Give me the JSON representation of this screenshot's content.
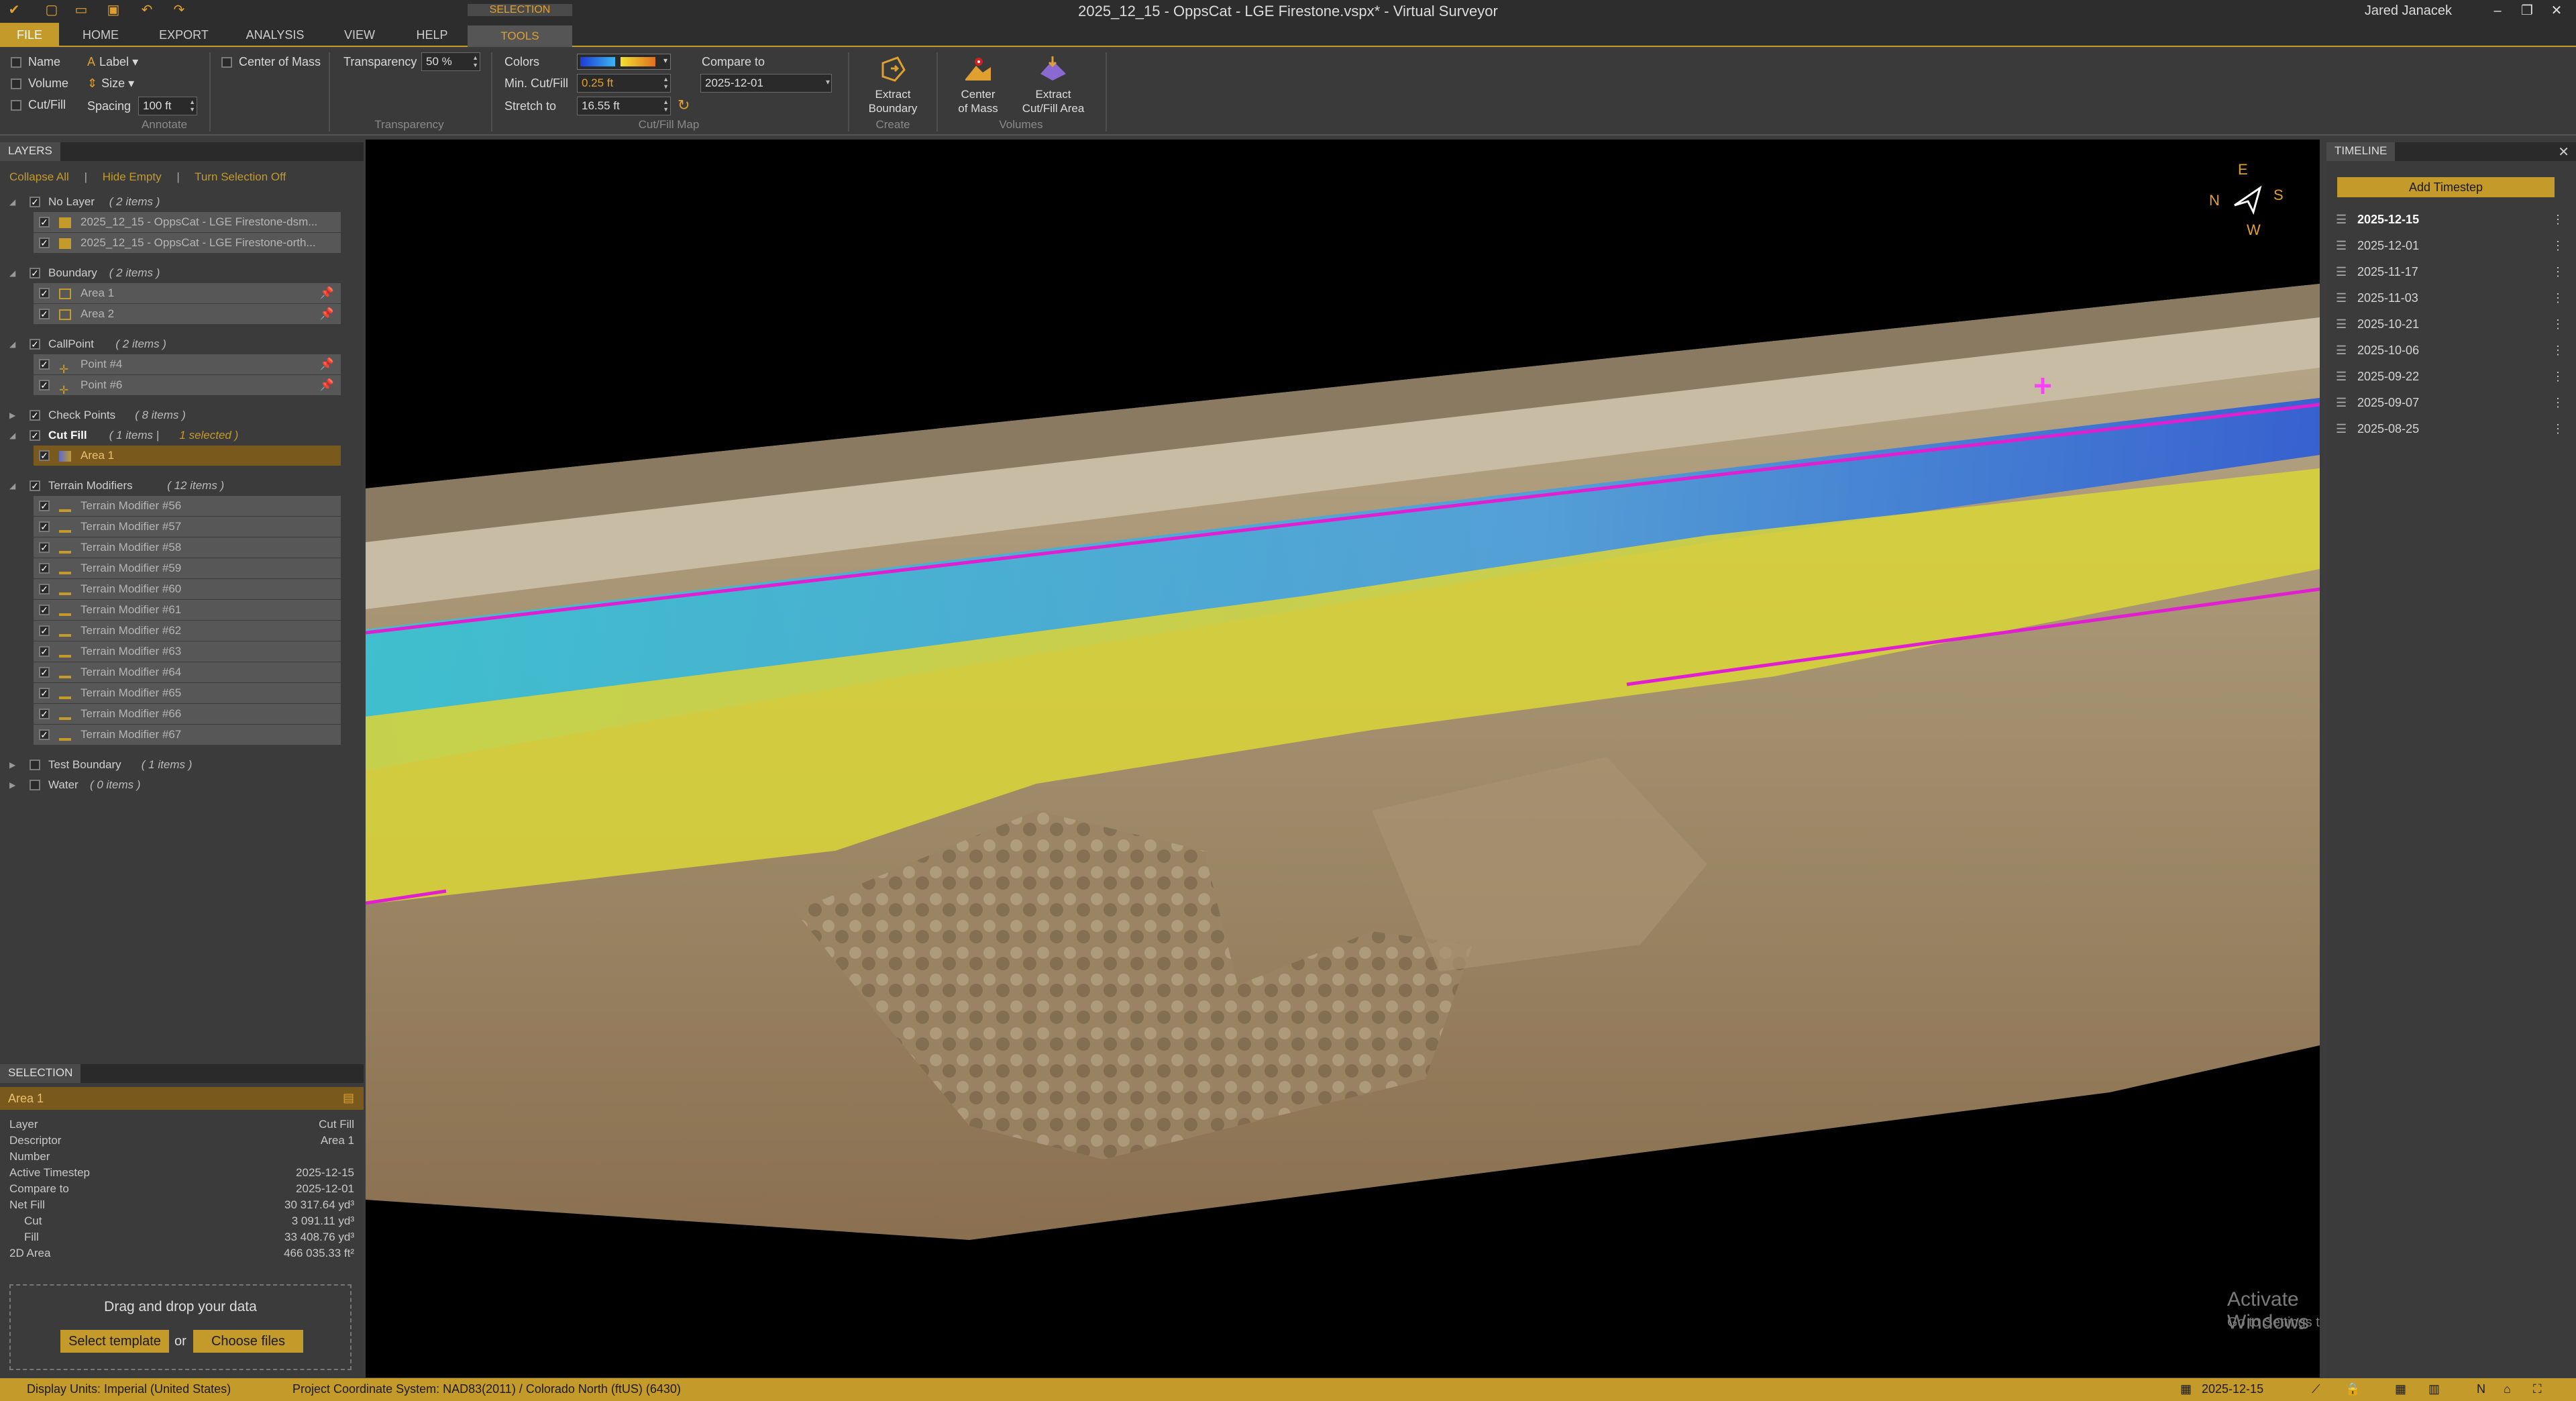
{
  "window": {
    "title": "2025_12_15 - OppsCat - LGE Firestone.vspx* - Virtual Surveyor",
    "user": "Jared Janacek"
  },
  "menu": {
    "tabs": [
      "FILE",
      "HOME",
      "EXPORT",
      "ANALYSIS",
      "VIEW",
      "HELP"
    ],
    "context_group": "SELECTION",
    "context_tab": "TOOLS"
  },
  "ribbon": {
    "annotate": {
      "name_label": "Name",
      "volume_label": "Volume",
      "cutfill_label": "Cut/Fill",
      "label_label": "Label",
      "size_label": "Size",
      "spacing_label": "Spacing",
      "spacing_value": "100 ft",
      "center_of_mass_label": "Center of Mass",
      "group_label": "Annotate"
    },
    "transparency": {
      "label": "Transparency",
      "value": "50 %",
      "group_label": "Transparency"
    },
    "cutfill_map": {
      "colors_label": "Colors",
      "min_cutfill_label": "Min. Cut/Fill",
      "min_cutfill_value": "0.25 ft",
      "stretch_label": "Stretch to",
      "stretch_value": "16.55 ft",
      "compare_label": "Compare to",
      "compare_value": "2025-12-01",
      "group_label": "Cut/Fill Map"
    },
    "create": {
      "extract_boundary_line1": "Extract",
      "extract_boundary_line2": "Boundary",
      "group_label": "Create"
    },
    "volumes": {
      "center_mass_line1": "Center",
      "center_mass_line2": "of Mass",
      "extract_cutfill_line1": "Extract",
      "extract_cutfill_line2": "Cut/Fill Area",
      "group_label": "Volumes"
    }
  },
  "layers": {
    "header": "LAYERS",
    "actions": [
      "Collapse All",
      "Hide Empty",
      "Turn Selection Off"
    ],
    "groups": [
      {
        "name": "No Layer",
        "count": "( 2 items )",
        "items": [
          "2025_12_15 - OppsCat - LGE Firestone-dsm...",
          "2025_12_15 - OppsCat - LGE Firestone-orth..."
        ]
      },
      {
        "name": "Boundary",
        "count": "( 2 items )",
        "items": [
          "Area 1",
          "Area 2"
        ]
      },
      {
        "name": "CallPoint",
        "count": "( 2 items )",
        "items": [
          "Point #4",
          "Point #6"
        ]
      },
      {
        "name": "Check Points",
        "count": "( 8 items )",
        "items": []
      },
      {
        "name": "Cut Fill",
        "count": "( 1 items |",
        "selected": "1 selected )",
        "items": [
          "Area 1"
        ]
      },
      {
        "name": "Terrain Modifiers",
        "count": "( 12 items )",
        "items": [
          "Terrain Modifier #56",
          "Terrain Modifier #57",
          "Terrain Modifier #58",
          "Terrain Modifier #59",
          "Terrain Modifier #60",
          "Terrain Modifier #61",
          "Terrain Modifier #62",
          "Terrain Modifier #63",
          "Terrain Modifier #64",
          "Terrain Modifier #65",
          "Terrain Modifier #66",
          "Terrain Modifier #67"
        ]
      },
      {
        "name": "Test Boundary",
        "count": "( 1 items )",
        "items": []
      },
      {
        "name": "Water",
        "count": "( 0 items )",
        "items": []
      }
    ]
  },
  "selection": {
    "header": "SELECTION",
    "title": "Area 1",
    "properties": [
      {
        "label": "Layer",
        "value": "Cut Fill"
      },
      {
        "label": "Descriptor",
        "value": "Area 1"
      },
      {
        "label": "Number",
        "value": ""
      },
      {
        "label": "Active Timestep",
        "value": "2025-12-15"
      },
      {
        "label": "Compare to",
        "value": "2025-12-01"
      },
      {
        "label": "Net Fill",
        "value": "30 317.64 yd³"
      },
      {
        "label": "Cut",
        "value": "3 091.11 yd³"
      },
      {
        "label": "Fill",
        "value": "33 408.76 yd³"
      },
      {
        "label": "2D Area",
        "value": "466 035.33 ft²"
      }
    ],
    "dropzone": {
      "text": "Drag and drop your data",
      "template_button": "Select template",
      "or": "or",
      "files_button": "Choose files"
    }
  },
  "viewport": {
    "compass": {
      "n": "N",
      "e": "E",
      "s": "S",
      "w": "W"
    },
    "watermark_line1": "Activate Windows",
    "watermark_line2": "Go to Settings to activate Windows."
  },
  "timeline": {
    "header": "TIMELINE",
    "add_button": "Add Timestep",
    "active": "2025-12-15",
    "dates": [
      "2025-12-15",
      "2025-12-01",
      "2025-11-17",
      "2025-11-03",
      "2025-10-21",
      "2025-10-06",
      "2025-09-22",
      "2025-09-07",
      "2025-08-25"
    ]
  },
  "statusbar": {
    "display_units": "Display Units:  Imperial (United States)",
    "coordinate_system": "Project Coordinate System:  NAD83(2011) / Colorado North (ftUS) (6430)",
    "date": "2025-12-15"
  },
  "colors": {
    "accent": "#c49a2a",
    "panel": "#3b3b3b",
    "cut": "#3ab7d6",
    "fill": "#d8d43a",
    "boundary": "#e020d0"
  }
}
